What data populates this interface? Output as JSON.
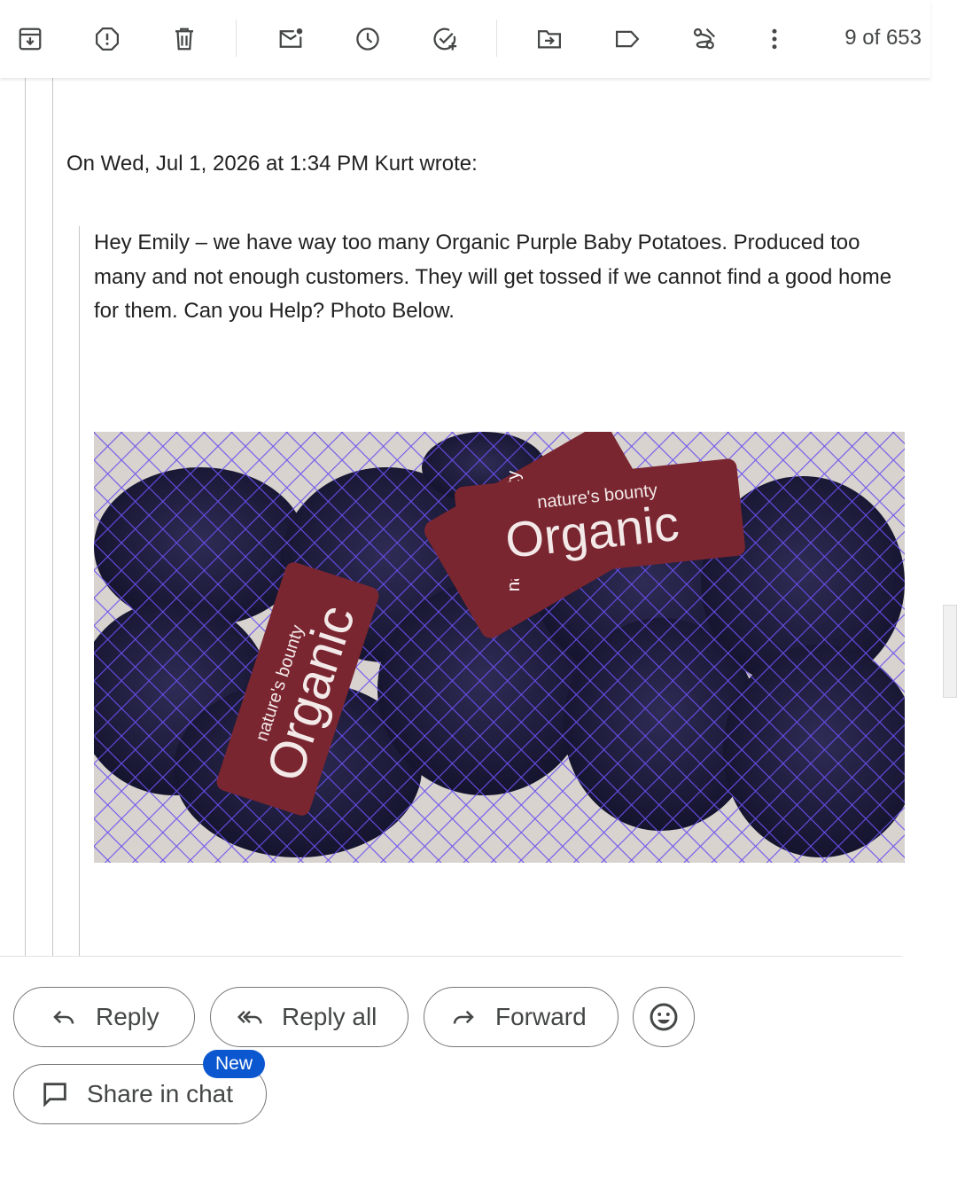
{
  "toolbar": {
    "counter": "9 of 653",
    "icons": [
      "archive-icon",
      "report-spam-icon",
      "delete-icon",
      "mark-unread-icon",
      "snooze-icon",
      "add-task-icon",
      "move-to-icon",
      "label-icon",
      "filter-icon",
      "more-icon"
    ]
  },
  "message": {
    "quote_header": "On Wed, Jul 1, 2026 at 1:34 PM Kurt wrote:",
    "body": "Hey Emily – we have way too many Organic Purple Baby Potatoes.  Produced too many and not enough customers.  They will get tossed if we cannot find a good home for them.  Can you Help?  Photo Below."
  },
  "photo": {
    "label_brand": "nature's bounty",
    "label_word": "Organic",
    "colors": {
      "net": "#5a3fd6",
      "label": "#7a2630",
      "potato": "#1e1d3a"
    }
  },
  "actions": {
    "reply": "Reply",
    "reply_all": "Reply all",
    "forward": "Forward",
    "share_in_chat": "Share in chat",
    "new_badge": "New"
  }
}
